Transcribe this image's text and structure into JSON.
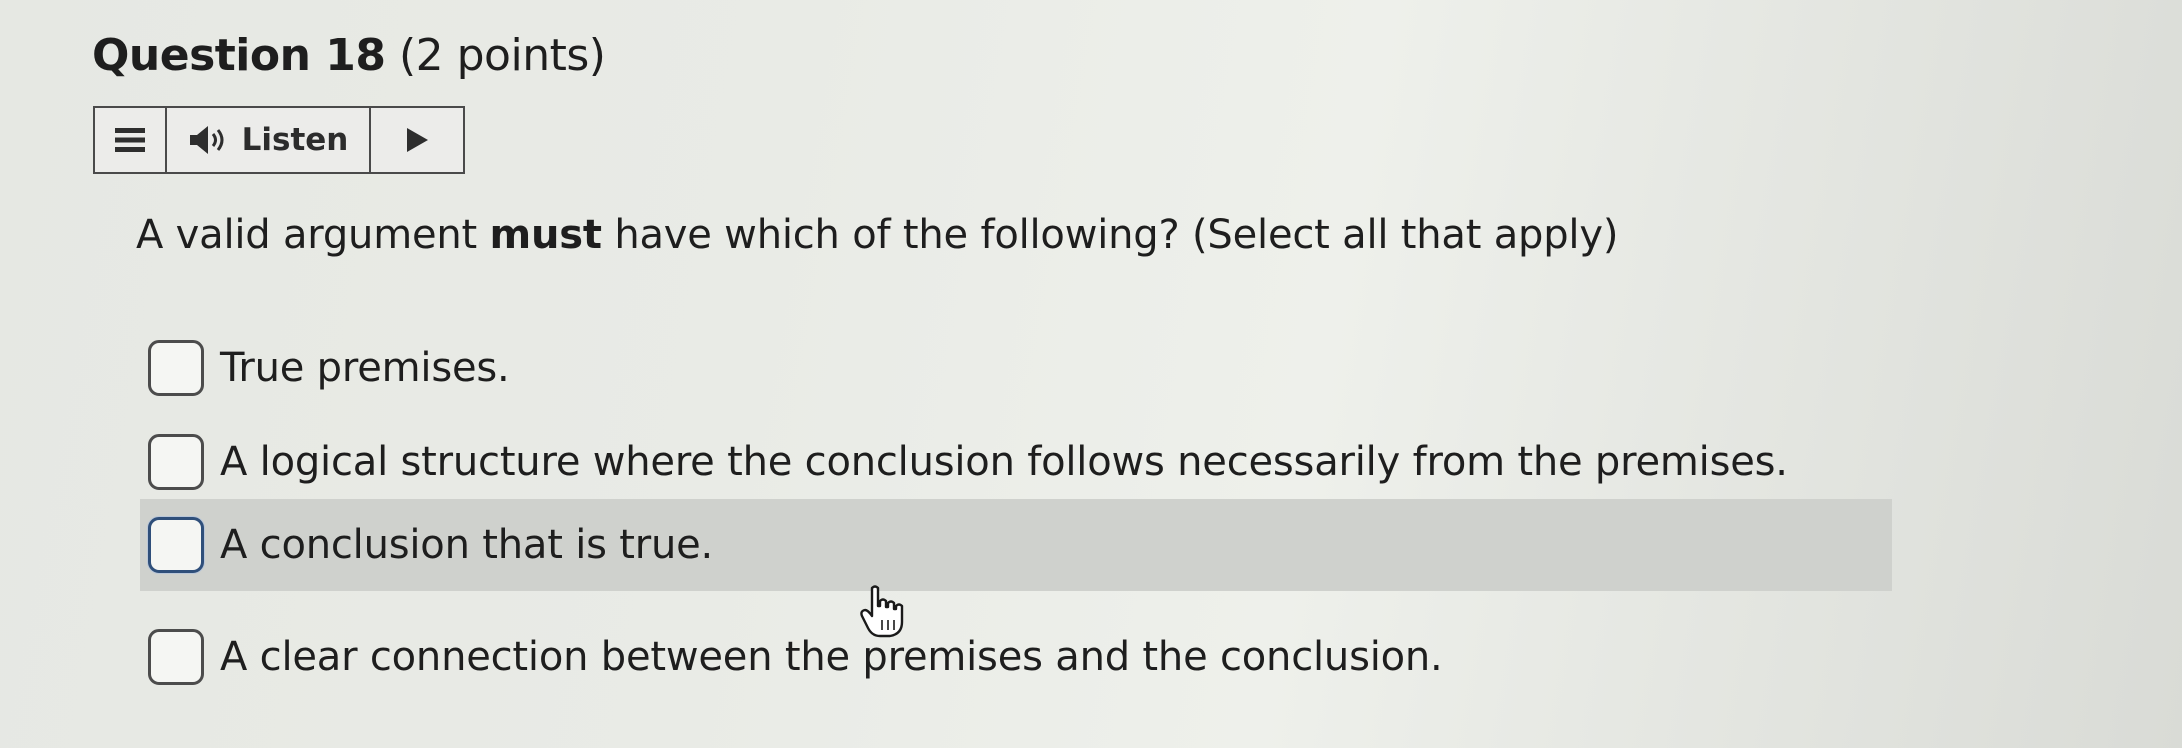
{
  "question": {
    "number_label": "Question 18",
    "points_label": "(2 points)"
  },
  "toolbar": {
    "menu_icon": "hamburger-icon",
    "speaker_icon": "speaker-icon",
    "listen_label": "Listen",
    "play_icon": "play-icon"
  },
  "prompt": {
    "before": "A valid argument ",
    "emphasis": "must",
    "after": " have which of the following? (Select all that apply)"
  },
  "options": [
    {
      "label": "True premises.",
      "checked": false
    },
    {
      "label": "A logical structure where the conclusion follows necessarily from the premises.",
      "checked": false
    },
    {
      "label": "A conclusion that is true.",
      "checked": false,
      "hovered": true
    },
    {
      "label": "A clear connection between the premises and the conclusion.",
      "checked": false
    }
  ],
  "colors": {
    "background": "#e9ebe6",
    "hover_highlight": "#cfd1cd",
    "checkbox_focus_border": "#2f4f7a",
    "text": "#1e1e1e"
  }
}
